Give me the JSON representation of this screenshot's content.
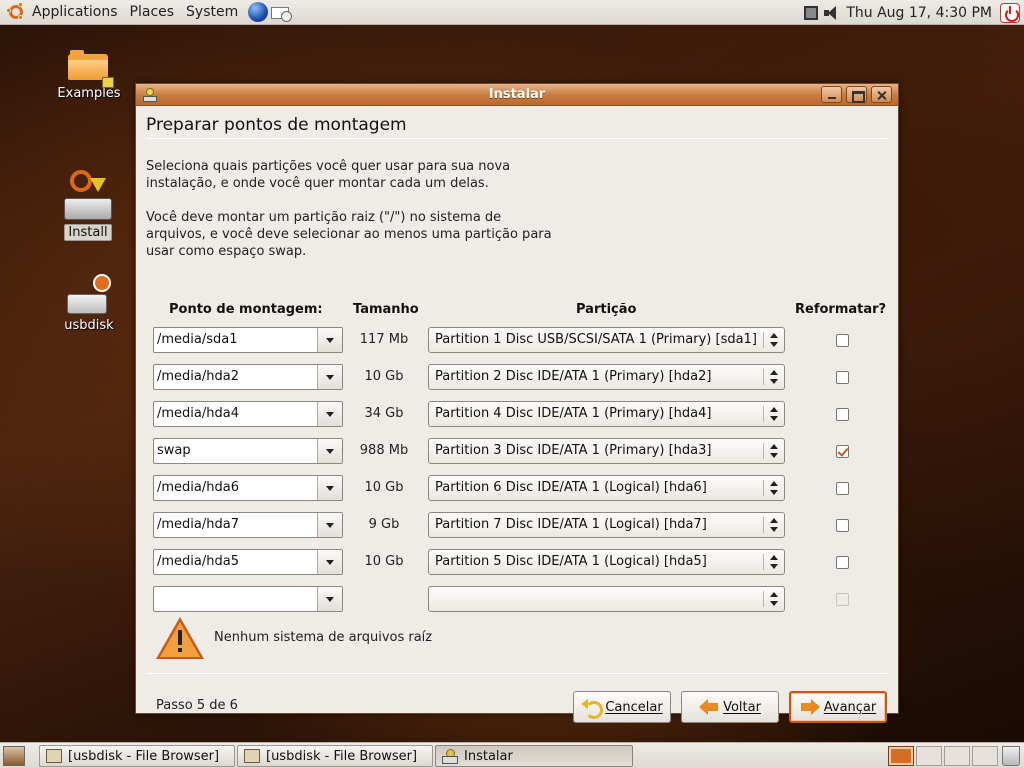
{
  "top_panel": {
    "menus": [
      "Applications",
      "Places",
      "System"
    ],
    "clock": "Thu Aug 17,  4:30 PM"
  },
  "desktop": {
    "icons": [
      {
        "label": "Examples"
      },
      {
        "label": "Install"
      },
      {
        "label": "usbdisk"
      }
    ]
  },
  "window": {
    "title": "Instalar",
    "page_title": "Preparar pontos de montagem",
    "para1_line1": "Seleciona quais partições você quer usar para sua nova",
    "para1_line2": "instalação, e onde você quer montar cada um delas.",
    "para2_line1": "Você deve montar um partição raiz (\"/\") no sistema de",
    "para2_line2": "arquivos, e você deve selecionar ao menos uma partição para",
    "para2_line3": "usar como espaço swap.",
    "columns": {
      "mount": "Ponto de montagem:",
      "size": "Tamanho",
      "partition": "Partição",
      "reformat": "Reformatar?"
    },
    "rows": [
      {
        "mount": "/media/sda1",
        "size": "117 Mb",
        "partition": "Partition 1 Disc USB/SCSI/SATA 1 (Primary) [sda1]",
        "reformat": false
      },
      {
        "mount": "/media/hda2",
        "size": "10 Gb",
        "partition": "Partition 2 Disc IDE/ATA 1 (Primary) [hda2]",
        "reformat": false
      },
      {
        "mount": "/media/hda4",
        "size": "34 Gb",
        "partition": "Partition 4 Disc IDE/ATA 1 (Primary) [hda4]",
        "reformat": false
      },
      {
        "mount": "swap",
        "size": "988 Mb",
        "partition": "Partition 3 Disc IDE/ATA 1 (Primary) [hda3]",
        "reformat": true
      },
      {
        "mount": "/media/hda6",
        "size": "10 Gb",
        "partition": "Partition 6 Disc IDE/ATA 1 (Logical) [hda6]",
        "reformat": false
      },
      {
        "mount": "/media/hda7",
        "size": "9 Gb",
        "partition": "Partition 7 Disc IDE/ATA 1 (Logical) [hda7]",
        "reformat": false
      },
      {
        "mount": "/media/hda5",
        "size": "10 Gb",
        "partition": "Partition 5 Disc IDE/ATA 1 (Logical) [hda5]",
        "reformat": false
      },
      {
        "mount": "",
        "size": "",
        "partition": "",
        "reformat": false
      }
    ],
    "warning": "Nenhum sistema de arquivos raíz",
    "step": "Passo 5 de 6",
    "buttons": {
      "cancel": "Cancelar",
      "back": "Voltar",
      "forward": "Avançar"
    }
  },
  "taskbar": {
    "tasks": [
      "[usbdisk - File Browser]",
      "[usbdisk - File Browser]",
      "Instalar"
    ]
  }
}
